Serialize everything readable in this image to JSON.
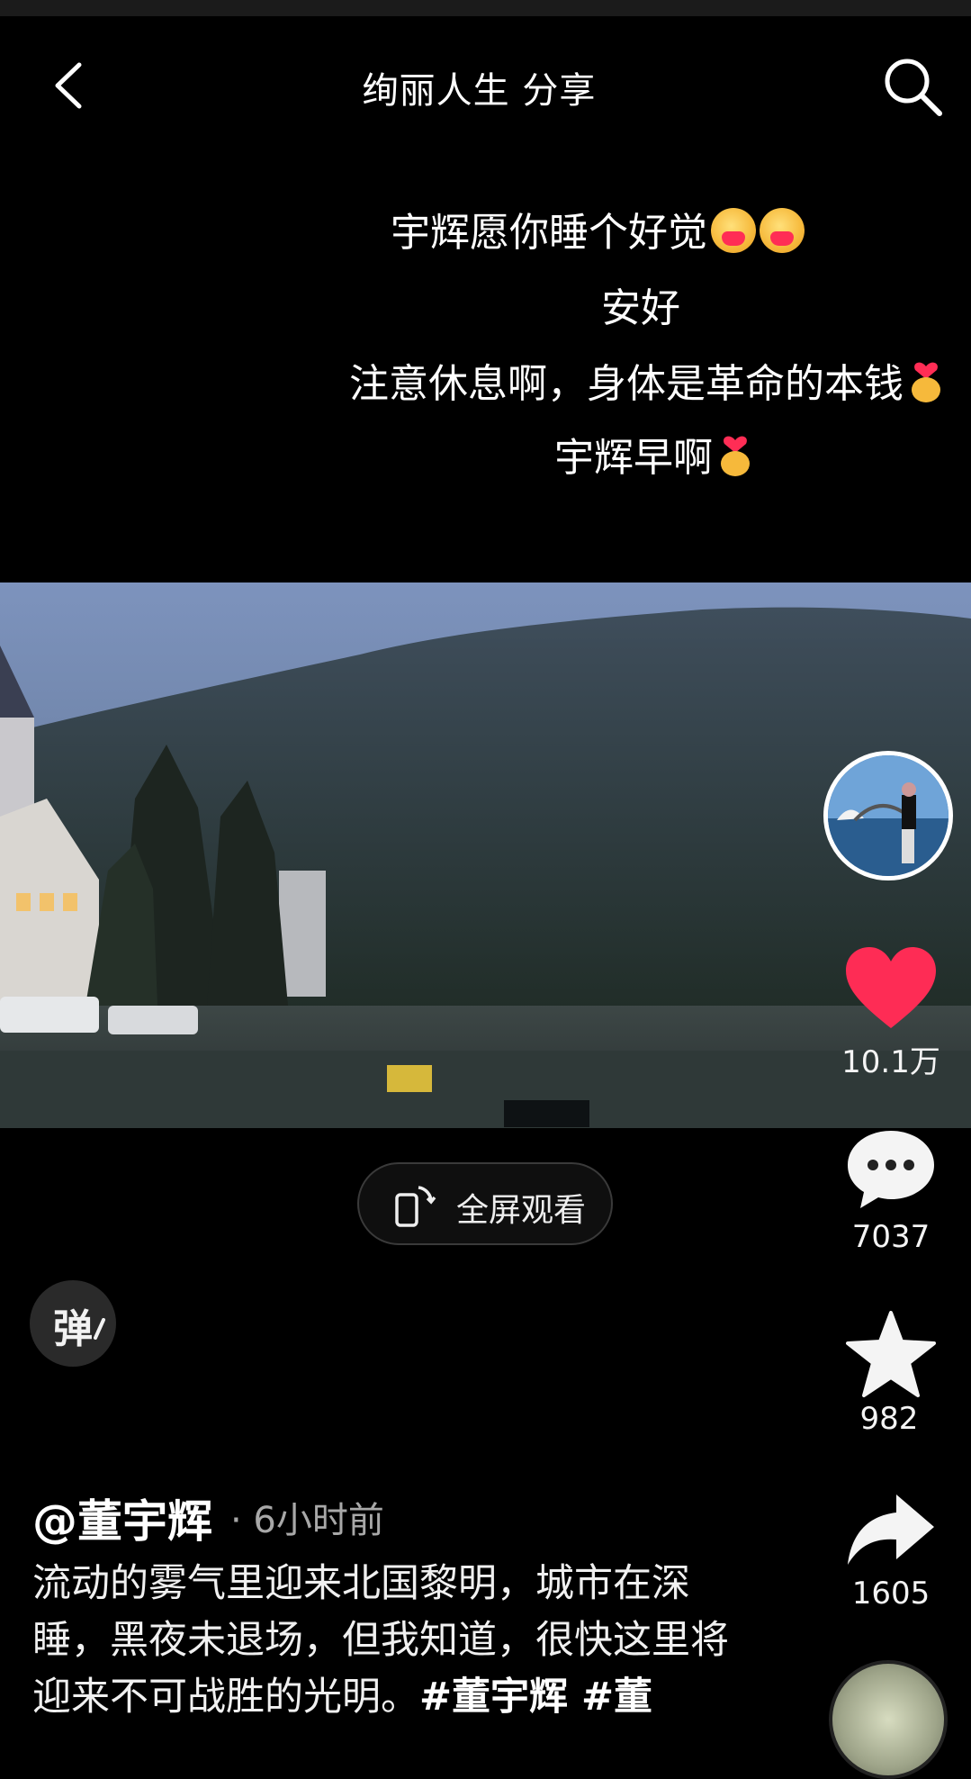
{
  "header": {
    "title": "绚丽人生 分享"
  },
  "comments": [
    "宇辉愿你睡个好觉",
    "安好",
    "注意休息啊，身体是革命的本钱",
    "宇辉早啊"
  ],
  "fullscreen_label": "全屏观看",
  "danmaku_label": "弹",
  "actions": {
    "likes": "10.1万",
    "comments": "7037",
    "favorites": "982",
    "shares": "1605"
  },
  "post": {
    "author": "@董宇辉",
    "time": "· 6小时前",
    "description": "流动的雾气里迎来北国黎明，城市在深睡，黑夜未退场，但我知道，很快这里将迎来不可战胜的光明。",
    "hashtags": "#董宇辉 #董"
  },
  "colors": {
    "like": "#fe2c55",
    "background": "#000000"
  }
}
